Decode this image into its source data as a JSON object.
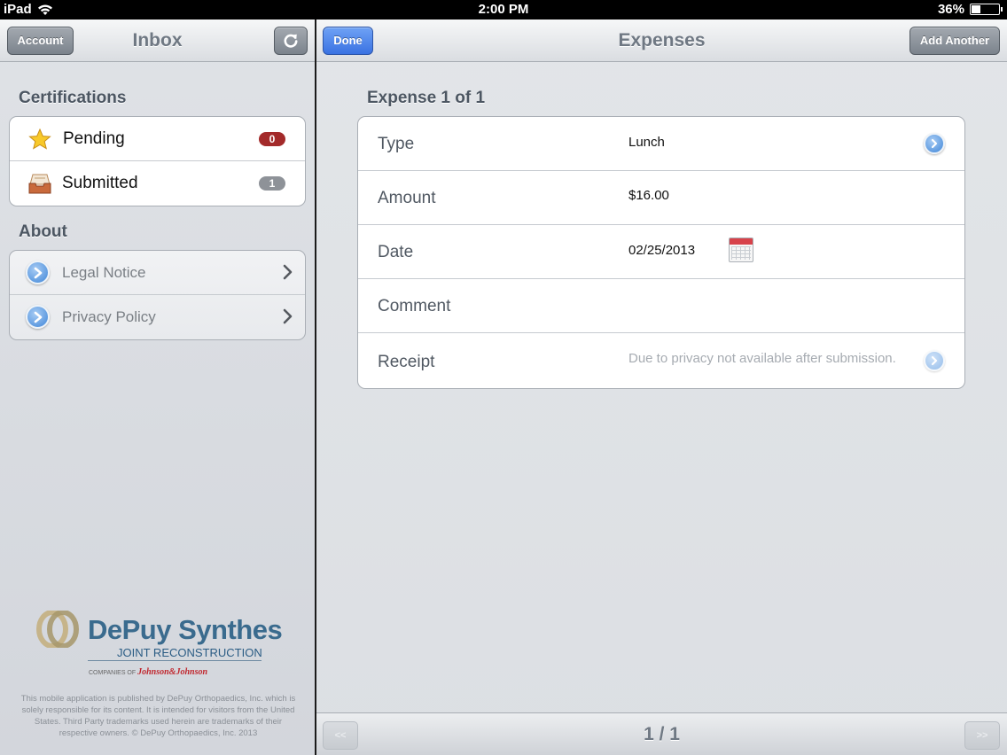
{
  "status_bar": {
    "carrier": "iPad",
    "time": "2:00 PM",
    "battery": "36%",
    "battery_level": 0.36
  },
  "inbox": {
    "title": "Inbox",
    "account_button": "Account",
    "certifications": {
      "heading": "Certifications",
      "items": [
        {
          "label": "Pending",
          "count": "0",
          "icon": "star-icon",
          "badge_color": "#a32a2a"
        },
        {
          "label": "Submitted",
          "count": "1",
          "icon": "inbox-tray-icon",
          "badge_color": "#8e9298"
        }
      ]
    },
    "about": {
      "heading": "About",
      "items": [
        {
          "label": "Legal Notice"
        },
        {
          "label": "Privacy Policy"
        }
      ]
    },
    "logo": {
      "brand": "DePuy Synthes",
      "subtitle": "JOINT RECONSTRUCTION",
      "companies_of": "COMPANIES OF",
      "parent": "Johnson&Johnson"
    },
    "disclaimer": "This mobile application is published by DePuy Orthopaedics, Inc. which is solely responsible for its content. It is intended for visitors from the United States. Third Party trademarks used herein are trademarks of their respective owners. © DePuy Orthopaedics, Inc. 2013"
  },
  "expenses": {
    "title": "Expenses",
    "done_button": "Done",
    "add_another_button": "Add Another",
    "heading": "Expense 1 of 1",
    "fields": {
      "type": {
        "label": "Type",
        "value": "Lunch"
      },
      "amount": {
        "label": "Amount",
        "value": "$16.00"
      },
      "date": {
        "label": "Date",
        "value": "02/25/2013"
      },
      "comment": {
        "label": "Comment",
        "value": ""
      },
      "receipt": {
        "label": "Receipt",
        "value": "Due to privacy not available after submission."
      }
    },
    "pager": {
      "prev": "<<",
      "next": ">>",
      "indicator": "1 / 1"
    }
  },
  "colors": {
    "accent_blue": "#3a72e2",
    "text_gray": "#6f7883"
  }
}
